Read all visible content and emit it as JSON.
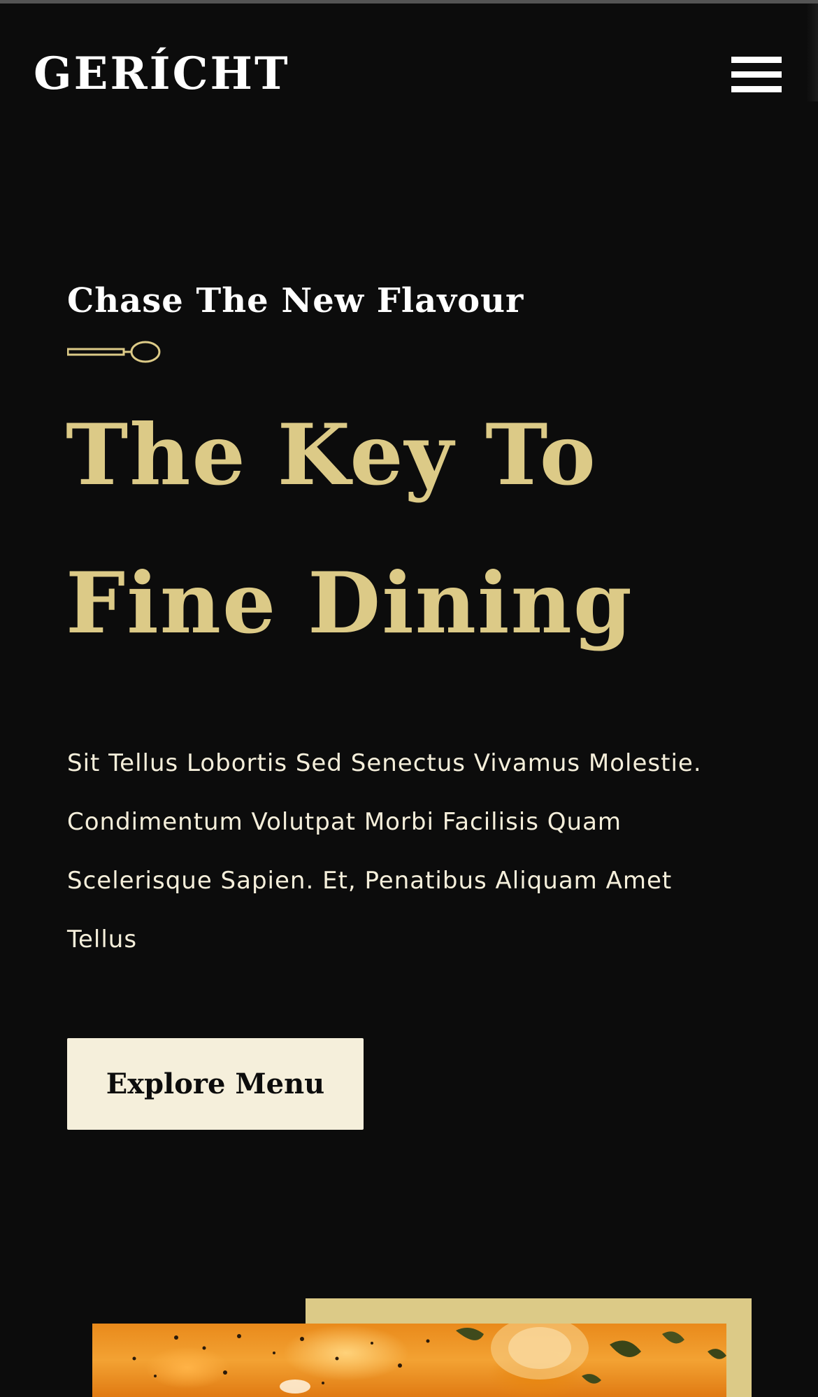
{
  "brand": {
    "logo_text": "GERÍCHT"
  },
  "nav": {
    "menu_icon": "hamburger-menu-icon"
  },
  "hero": {
    "subtitle": "Chase The New Flavour",
    "divider_icon": "spoon-icon",
    "headline_line1": "The Key To",
    "headline_line2": "Fine Dining",
    "description": "Sit Tellus Lobortis Sed Senectus Vivamus Molestie. Condimentum Volutpat Morbi Facilisis Quam Scelerisque Sapien. Et, Penatibus Aliquam Amet Tellus",
    "cta_label": "Explore Menu"
  },
  "colors": {
    "background": "#0c0c0c",
    "golden": "#dcca87",
    "crimson": "#f5efdb",
    "white": "#ffffff"
  }
}
